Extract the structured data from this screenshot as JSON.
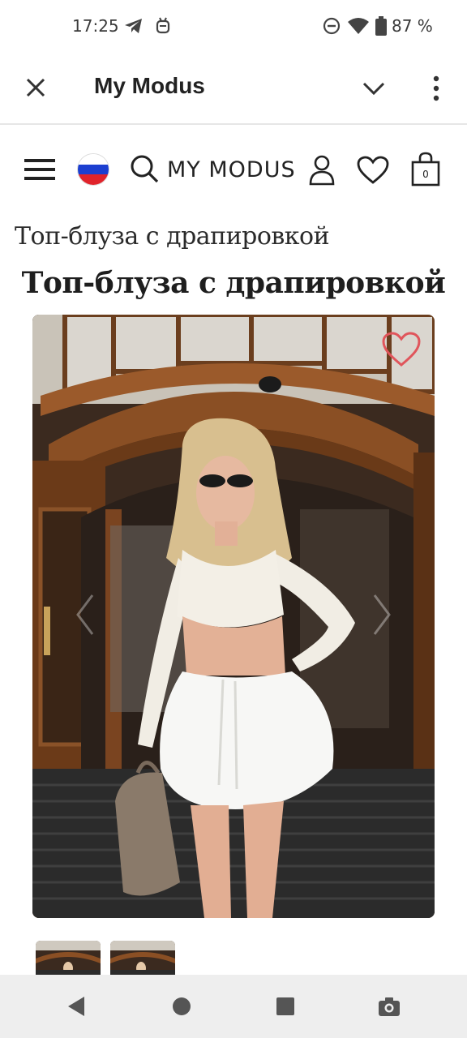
{
  "status_bar": {
    "time": "17:25",
    "icons": [
      "telegram-icon",
      "android-debug-icon",
      "do-not-disturb-icon",
      "wifi-icon",
      "battery-icon"
    ],
    "battery": "87 %"
  },
  "app_bar": {
    "title": "My Modus",
    "icons": [
      "close-icon",
      "chevron-down-icon",
      "more-vert-icon"
    ]
  },
  "site_header": {
    "logo_text": "MY MODUS",
    "cart_count": "0",
    "icons": [
      "menu-icon",
      "russia-flag-icon",
      "search-icon",
      "user-icon",
      "heart-icon",
      "shopping-bag-icon"
    ]
  },
  "product": {
    "breadcrumb_title": "Топ-блуза с драпировкой",
    "title": "Топ-блуза с драпировкой",
    "favorite_icon": "heart-outline-icon",
    "thumbnail_count": 2
  },
  "nav_bar": {
    "icons": [
      "back-icon",
      "home-icon",
      "recents-icon",
      "screenshot-icon"
    ]
  },
  "colors": {
    "accent_heart": "#e0555b",
    "appbar_text": "#222222",
    "navbar_bg": "#eeeeee"
  }
}
